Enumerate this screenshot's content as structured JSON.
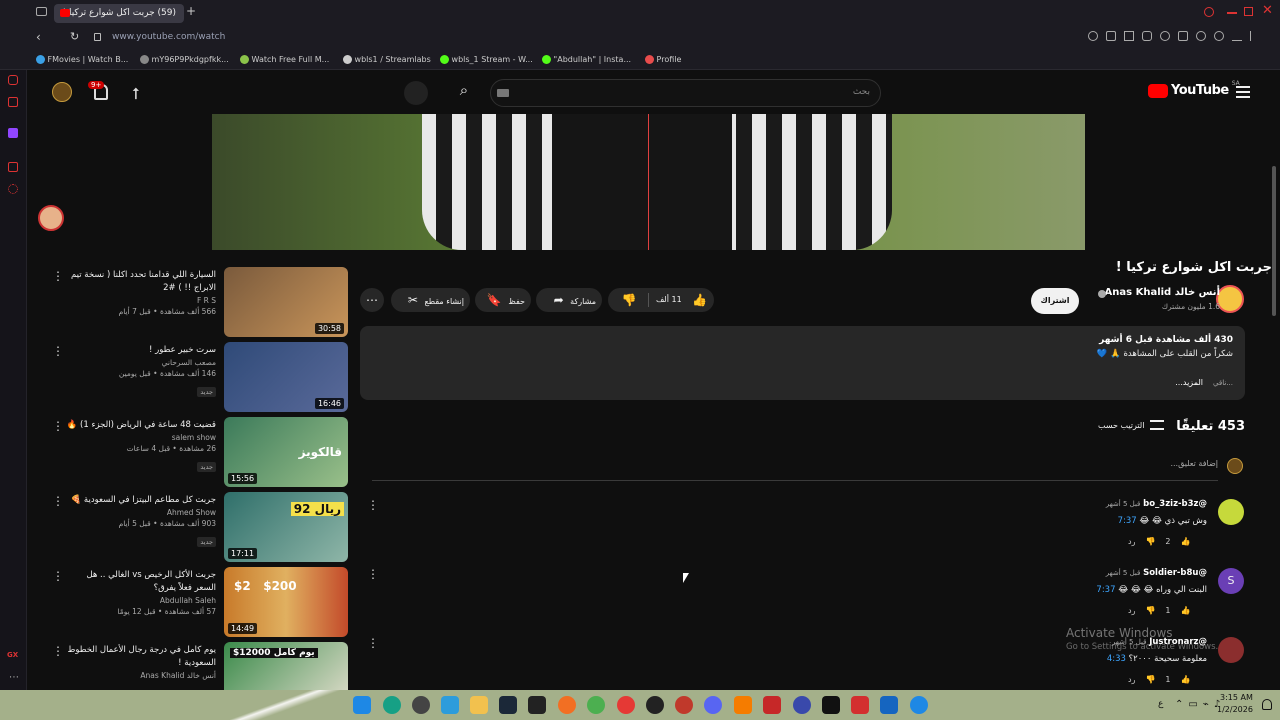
{
  "browser": {
    "tab_title": "(59) جربت اكل شوارع تركيا !",
    "new_tab": "+",
    "url": "www.youtube.com/watch",
    "bookmarks": [
      {
        "label": "FMovies | Watch B...",
        "color": "#3aa0e6"
      },
      {
        "label": "mY96P9Pkdgpfkk...",
        "color": "#888888"
      },
      {
        "label": "Watch Free Full M...",
        "color": "#8bc34a"
      },
      {
        "label": "wbls1 / Streamlabs",
        "color": "#cccccc"
      },
      {
        "label": "wbls_1 Stream - W...",
        "color": "#53fc18"
      },
      {
        "label": "\"Abdullah\" | Insta...",
        "color": "#53fc18"
      },
      {
        "label": "Profile",
        "color": "#e84c4c"
      }
    ],
    "sidebar_badge": "GX"
  },
  "youtube": {
    "logo_text": "YouTube",
    "region": "SA",
    "search_placeholder": "بحث",
    "notif_count": "9+",
    "video": {
      "title": "جربت اكل شوارع تركيا !",
      "channel": "أنس خالد Anas Khalid",
      "subscribers": "1.6 مليون مشترك",
      "subscribe": "اشتراك",
      "likes": "11 ألف",
      "share": "مشاركة",
      "save": "حفظ",
      "clip": "إنشاء مقطع",
      "views_time": "430 ألف مشاهدة  قبل 6 أشهر",
      "description": "شكراً من القلب على المشاهدة 🙏 💙",
      "more": "...المزيد",
      "more_prefix": "ناقي..."
    },
    "comments": {
      "count": "453 تعليقًا",
      "sort": "الترتيب حسب",
      "add_placeholder": "إضافة تعليق...",
      "items": [
        {
          "author": "@bo_3ziz-b3z",
          "time": "قبل 5 أشهر",
          "text": "وش تبي ذي 😂 😂",
          "timestamp": "7:37",
          "likes": "2",
          "reply": "رد",
          "avatar_color": "#c6d93b"
        },
        {
          "author": "@Soldier-b8u",
          "time": "قبل 5 أشهر",
          "text": "البنت الي وراه 😂 😂 😂",
          "timestamp": "7:37",
          "likes": "1",
          "reply": "رد",
          "avatar_color": "#6a3fb5",
          "avatar_letter": "S"
        },
        {
          "author": "@Justronarz",
          "time": "قبل 5 أشهر",
          "text": "معلومة سحيحة ٢٠٠٠؟",
          "timestamp": "4:33",
          "likes": "1",
          "reply": "رد",
          "avatar_color": "#8b2e2e"
        }
      ]
    },
    "recommended": [
      {
        "title": "السيارة اللي قدامنا تحدد اكلنا ( نسخة تيم الابراج !! ) #2",
        "channel": "F R S",
        "meta": "566 ألف مشاهدة • قبل 7 أيام",
        "duration": "30:58",
        "badge": "",
        "color": "#7a5a3c"
      },
      {
        "title": "سرت خبير عطور !",
        "channel": "مصعب السرحاني",
        "meta": "146 ألف مشاهدة • قبل يومين",
        "duration": "16:46",
        "badge": "جديد",
        "color": "#2f4a78"
      },
      {
        "title": "قضيت 48 ساعة في الرياض (الجزء 1) 🔥",
        "channel": "salem show",
        "meta": "26 مشاهدة • قبل 4 ساعات",
        "duration": "15:56",
        "badge": "جديد",
        "color": "#3b7a5a"
      },
      {
        "title": "جربت كل مطاعم البيتزا في السعودية 🍕",
        "channel": "Ahmed Show",
        "meta": "903 ألف مشاهدة • قبل 5 أيام",
        "duration": "17:11",
        "badge": "جديد",
        "color": "#2f6f6a"
      },
      {
        "title": "جربت الأكل الرخيص vs الغالي .. هل السعر فعلاً يفرق؟",
        "channel": "Abdullah Saleh",
        "meta": "57 ألف مشاهدة • قبل 12 يومًا",
        "duration": "14:49",
        "badge": "",
        "color": "#c87a2a"
      },
      {
        "title": "يوم كامل في درجة رجال الأعمال الخطوط السعودية !",
        "channel": "أنس خالد Anas Khalid",
        "meta": "",
        "duration": "",
        "badge": "",
        "color": "#3a8a4a"
      }
    ],
    "thumb_texts": [
      "",
      "",
      "قالكويز",
      "92 ريال",
      "$2   $200",
      "$12000 يوم كامل"
    ]
  },
  "overlay": {
    "activate_title": "Activate Windows",
    "activate_sub": "Go to Settings to activate Windows."
  },
  "taskbar": {
    "time": "3:15 AM",
    "date": "1/2/2026",
    "lang": "ع"
  }
}
